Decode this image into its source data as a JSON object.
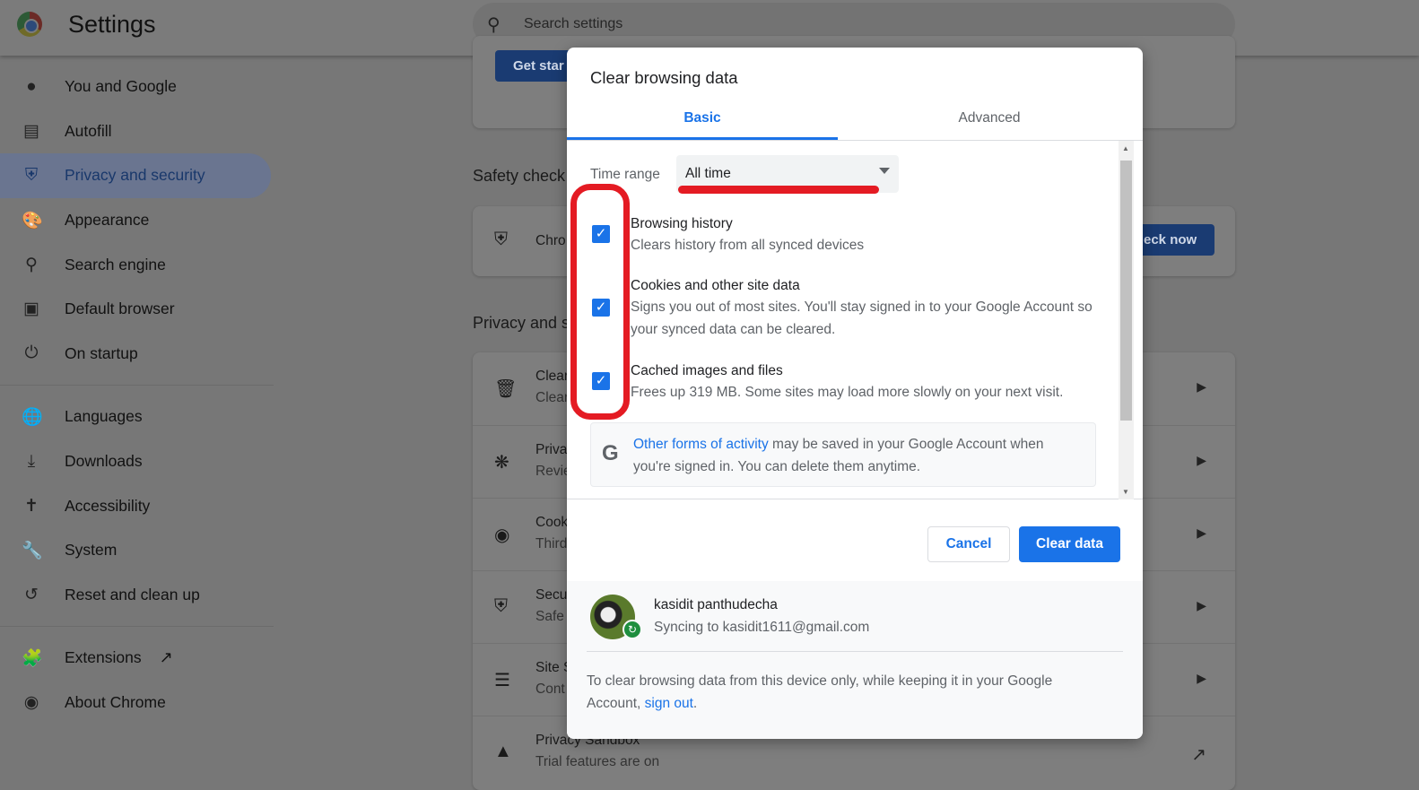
{
  "header": {
    "title": "Settings",
    "search_placeholder": "Search settings"
  },
  "sidebar": {
    "items": [
      {
        "label": "You and Google",
        "icon": "person-icon"
      },
      {
        "label": "Autofill",
        "icon": "clipboard-icon"
      },
      {
        "label": "Privacy and security",
        "icon": "shield-icon",
        "selected": true
      },
      {
        "label": "Appearance",
        "icon": "palette-icon"
      },
      {
        "label": "Search engine",
        "icon": "search-icon"
      },
      {
        "label": "Default browser",
        "icon": "browser-icon"
      },
      {
        "label": "On startup",
        "icon": "power-icon"
      },
      {
        "label": "Languages",
        "icon": "globe-icon"
      },
      {
        "label": "Downloads",
        "icon": "download-icon"
      },
      {
        "label": "Accessibility",
        "icon": "accessibility-icon"
      },
      {
        "label": "System",
        "icon": "wrench-icon"
      },
      {
        "label": "Reset and clean up",
        "icon": "history-icon"
      },
      {
        "label": "Extensions",
        "icon": "puzzle-icon"
      },
      {
        "label": "About Chrome",
        "icon": "chrome-icon"
      }
    ]
  },
  "main": {
    "get_started": "Get star",
    "safety_check_title": "Safety check",
    "safety_row": "Chro",
    "check_now": "eck now",
    "privacy_title": "Privacy and s",
    "rows": [
      {
        "t1": "Clear",
        "t2": "Clear",
        "icon": "trash-icon"
      },
      {
        "t1": "Priva",
        "t2": "Revie",
        "icon": "compass-icon"
      },
      {
        "t1": "Cook",
        "t2": "Third",
        "icon": "cookie-icon"
      },
      {
        "t1": "Secu",
        "t2": "Safe",
        "icon": "shield-half-icon"
      },
      {
        "t1": "Site S",
        "t2": "Cont",
        "icon": "tune-icon"
      },
      {
        "t1": "Privacy Sandbox",
        "t2": "Trial features are on",
        "icon": "flask-icon"
      }
    ]
  },
  "dialog": {
    "title": "Clear browsing data",
    "tabs": [
      {
        "label": "Basic",
        "active": true
      },
      {
        "label": "Advanced"
      }
    ],
    "time_range_label": "Time range",
    "time_range_value": "All time",
    "items": [
      {
        "title": "Browsing history",
        "desc": "Clears history from all synced devices",
        "checked": true
      },
      {
        "title": "Cookies and other site data",
        "desc": "Signs you out of most sites. You'll stay signed in to your Google Account so your synced data can be cleared.",
        "checked": true
      },
      {
        "title": "Cached images and files",
        "desc": "Frees up 319 MB. Some sites may load more slowly on your next visit.",
        "checked": true
      }
    ],
    "google_notice": {
      "link": "Other forms of activity",
      "text": " may be saved in your Google Account when you're signed in. You can delete them anytime."
    },
    "cancel": "Cancel",
    "clear": "Clear data",
    "account": {
      "name": "kasidit panthudecha",
      "sync": "Syncing to kasidit1611@gmail.com"
    },
    "footer_note": {
      "text": "To clear browsing data from this device only, while keeping it in your Google Account, ",
      "link": "sign out",
      "end": "."
    }
  },
  "colors": {
    "accent": "#1a73e8",
    "annotation": "#e41b23"
  }
}
